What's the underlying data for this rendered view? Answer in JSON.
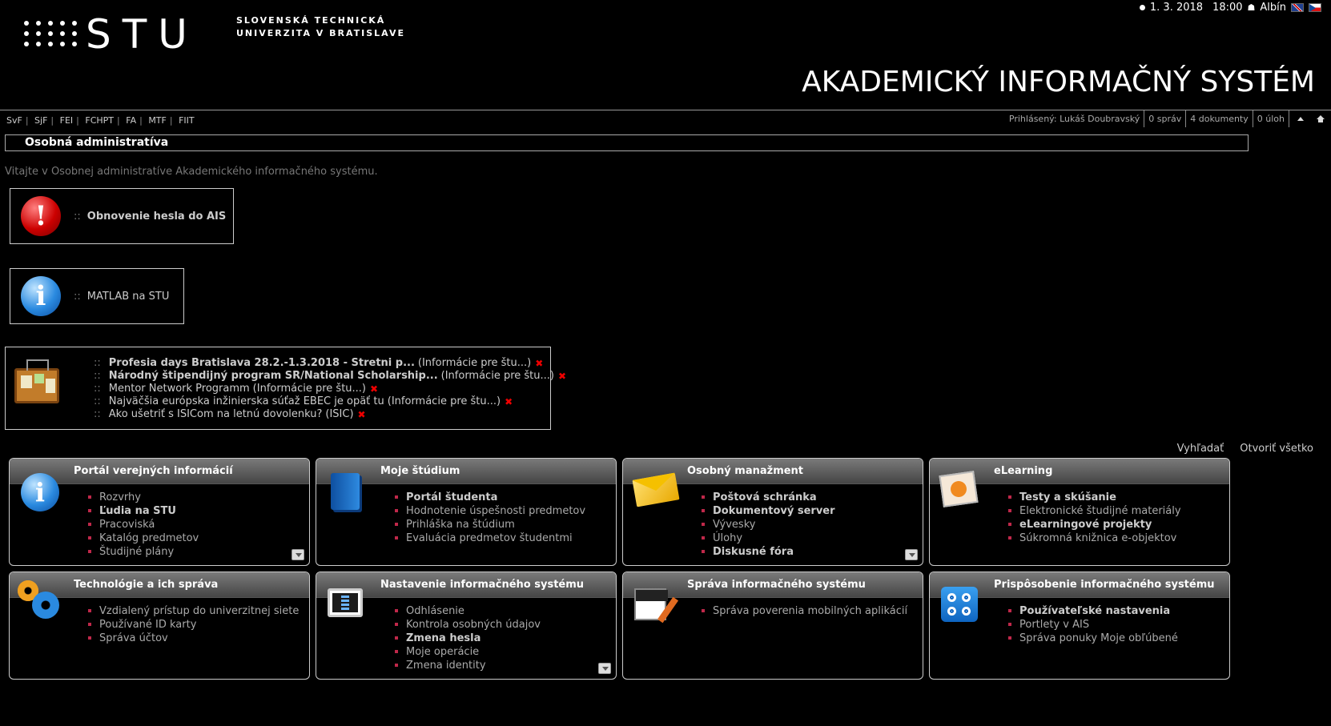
{
  "header": {
    "logo_text": "STU",
    "university_line1": "SLOVENSKÁ TECHNICKÁ",
    "university_line2": "UNIVERZITA V BRATISLAVE",
    "date": "1. 3. 2018",
    "time": "18:00",
    "user_short": "Albín",
    "system_title": "AKADEMICKÝ INFORMAČNÝ SYSTÉM"
  },
  "faculties": [
    "SvF",
    "SjF",
    "FEI",
    "FCHPT",
    "FA",
    "MTF",
    "FIIT"
  ],
  "userbar": {
    "logged_in": "Prihlásený: Lukáš Doubravský",
    "messages": "0 správ",
    "documents": "4 dokumenty",
    "tasks": "0 úloh"
  },
  "section_title": "Osobná administratíva",
  "welcome": "Vitajte v Osobnej administratíve Akademického informačného systému.",
  "notices": [
    {
      "colons": "::",
      "label": "Obnovenie hesla do AIS",
      "icon": "alert-icon"
    },
    {
      "colons": "::",
      "label": "MATLAB na STU",
      "icon": "info-icon"
    }
  ],
  "board": {
    "items": [
      {
        "title": "Profesia days Bratislava 28.2.-1.3.2018 - Stretni p...",
        "category": "(Informácie pre štu...)",
        "bold": true
      },
      {
        "title": "Národný štipendijný program SR/National Scholarship...",
        "category": "(Informácie pre štu...)",
        "bold": true
      },
      {
        "title": "Mentor Network Programm",
        "category": "(Informácie pre štu...)",
        "bold": false
      },
      {
        "title": "Najväčšia európska inžinierska súťaž EBEC je opäť tu",
        "category": "(Informácie pre štu...)",
        "bold": false
      },
      {
        "title": "Ako ušetriť s ISICom na letnú dovolenku?",
        "category": "(ISIC)",
        "bold": false
      }
    ]
  },
  "actions": {
    "search": "Vyhľadať",
    "open_all": "Otvoriť všetko"
  },
  "portlets": [
    {
      "title": "Portál verejných informácií",
      "items": [
        "Rozvrhy",
        "Ľudia na STU",
        "Pracoviská",
        "Katalóg predmetov",
        "Študijné plány"
      ]
    },
    {
      "title": "Moje štúdium",
      "items": [
        "Portál študenta",
        "Hodnotenie úspešnosti predmetov",
        "Prihláška na štúdium",
        "Evaluácia predmetov študentmi"
      ]
    },
    {
      "title": "Osobný manažment",
      "items": [
        "Poštová schránka",
        "Dokumentový server",
        "Vývesky",
        "Úlohy",
        "Diskusné fóra"
      ]
    },
    {
      "title": "eLearning",
      "items": [
        "Testy a skúšanie",
        "Elektronické študijné materiály",
        "eLearningové projekty",
        "Súkromná knižnica e-objektov"
      ]
    },
    {
      "title": "Technológie a ich správa",
      "items": [
        "Vzdialený prístup do univerzitnej siete",
        "Používané ID karty",
        "Správa účtov"
      ]
    },
    {
      "title": "Nastavenie informačného systému",
      "items": [
        "Odhlásenie",
        "Kontrola osobných údajov",
        "Zmena hesla",
        "Moje operácie",
        "Zmena identity"
      ]
    },
    {
      "title": "Správa informačného systému",
      "items": [
        "Správa poverenia mobilných aplikácií"
      ]
    },
    {
      "title": "Prispôsobenie informačného systému",
      "items": [
        "Používateľské nastavenia",
        "Portlety v AIS",
        "Správa ponuky Moje obľúbené"
      ]
    }
  ]
}
